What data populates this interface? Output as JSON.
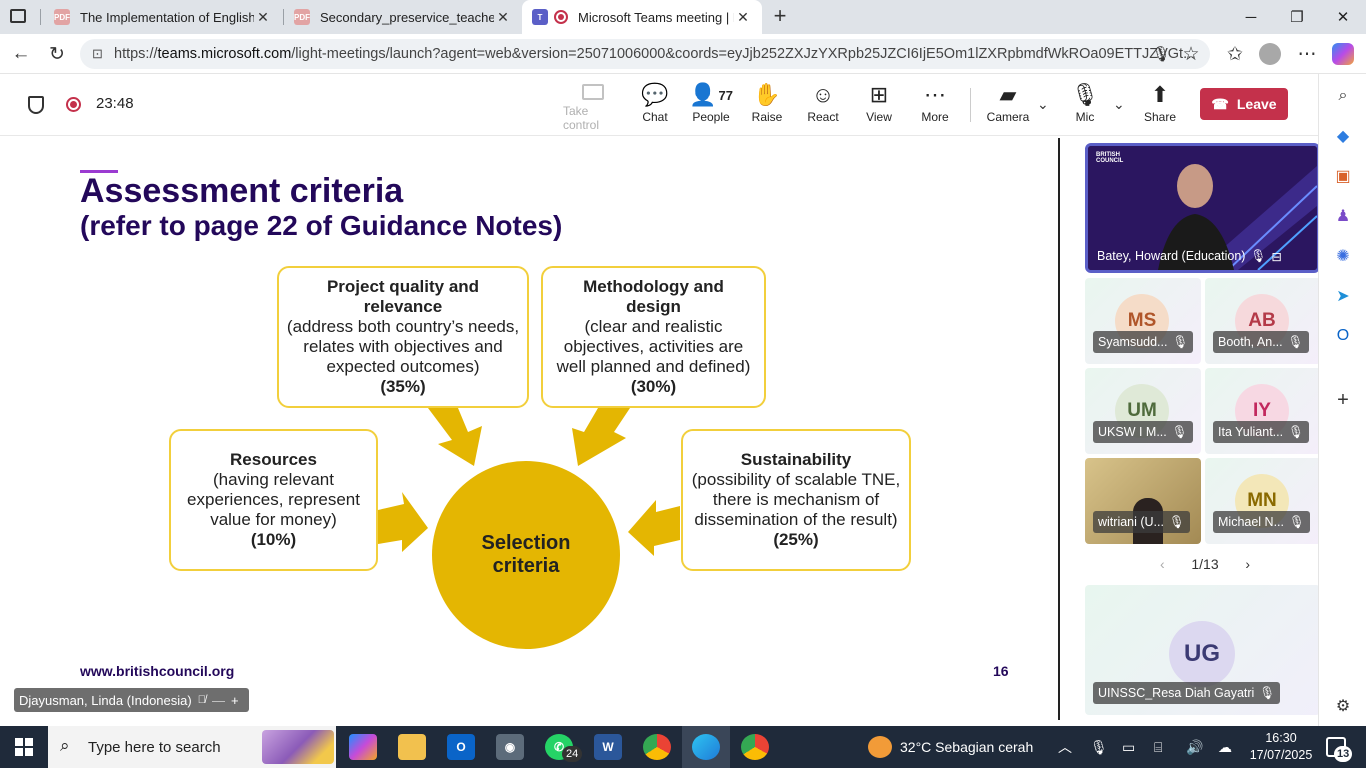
{
  "browser": {
    "tabs": [
      {
        "title": "The Implementation of English Le",
        "icon": "pdf-icon"
      },
      {
        "title": "Secondary_preservice_teachers_C",
        "icon": "pdf-icon"
      },
      {
        "title": "Microsoft Teams meeting | M",
        "icon": "teams-recording-icon"
      }
    ],
    "url_prefix": "https://",
    "url_host": "teams.microsoft.com",
    "url_rest": "/light-meetings/launch?agent=web&version=25071006000&coords=eyJjb252ZXJzYXRpb25JZCI6IjE5Om1lZXRpbmdfWkROa09ETTJZVGt..."
  },
  "meeting": {
    "timer": "23:48",
    "toolbar": {
      "take_control": "Take control",
      "chat": "Chat",
      "people": "People",
      "people_count": "77",
      "raise": "Raise",
      "react": "React",
      "view": "View",
      "more": "More",
      "camera": "Camera",
      "mic": "Mic",
      "share": "Share",
      "leave": "Leave"
    }
  },
  "slide": {
    "title": "Assessment criteria",
    "subtitle": "(refer to page 22 of Guidance Notes)",
    "boxes": {
      "project": {
        "heading": "Project quality and relevance",
        "body": "(address both country’s needs, relates with objectives and expected outcomes)",
        "pct": "(35%)"
      },
      "method": {
        "heading": "Methodology and design",
        "body": "(clear and realistic objectives, activities are well planned and defined)",
        "pct": "(30%)"
      },
      "resources": {
        "heading": "Resources",
        "body": "(having relevant experiences, represent value for money)",
        "pct": "(10%)"
      },
      "sustain": {
        "heading": "Sustainability",
        "body": "(possibility of scalable TNE, there is mechanism of dissemination of the result)",
        "pct": "(25%)"
      }
    },
    "center_line1": "Selection",
    "center_line2": "criteria",
    "footer_url": "www.britishcouncil.org",
    "page_number": "16",
    "presenter": "Djayusman, Linda (Indonesia)"
  },
  "participants": {
    "speaker": "Batey, Howard (Education)",
    "speaker_logo": "BRITISH COUNCIL",
    "tiles": [
      {
        "initials": "MS",
        "name": "Syamsudd...",
        "color": "#f5dcc8",
        "text": "#b0562a"
      },
      {
        "initials": "AB",
        "name": "Booth, An...",
        "color": "#f6d9dc",
        "text": "#b43a48"
      },
      {
        "initials": "UM",
        "name": "UKSW I M...",
        "color": "#dfe9d7",
        "text": "#4f6b3c"
      },
      {
        "initials": "IY",
        "name": "Ita Yuliant...",
        "color": "#f7d8e3",
        "text": "#c2285e"
      },
      {
        "initials": "",
        "name": "witriani (U...",
        "color": "#d9c58a",
        "text": "#333"
      },
      {
        "initials": "MN",
        "name": "Michael N...",
        "color": "#f3e7b8",
        "text": "#8a6a00"
      }
    ],
    "pager": "1/13",
    "big_tile": {
      "initials": "UG",
      "name": "UINSSC_Resa Diah Gayatri"
    }
  },
  "taskbar": {
    "search_placeholder": "Type here to search",
    "whatsapp_badge": "24",
    "weather": "32°C  Sebagian cerah",
    "time": "16:30",
    "date": "17/07/2025",
    "notif_count": "13"
  }
}
